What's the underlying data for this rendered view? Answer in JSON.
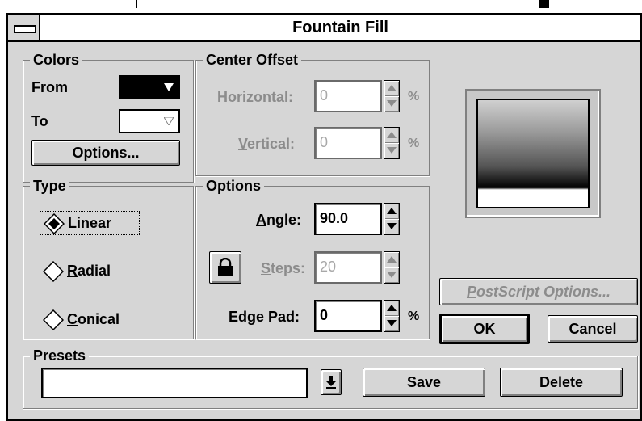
{
  "window": {
    "title": "Fountain Fill"
  },
  "colors": {
    "legend": "Colors",
    "from_label": "From",
    "to_label": "To",
    "from_color": "#000000",
    "to_color": "#ffffff",
    "options_button": "Options..."
  },
  "center_offset": {
    "legend": "Center Offset",
    "horizontal_label_accel": "H",
    "horizontal_label_rest": "orizontal:",
    "horizontal_value": "0",
    "vertical_label_accel": "V",
    "vertical_label_rest": "ertical:",
    "vertical_value": "0",
    "unit": "%"
  },
  "type": {
    "legend": "Type",
    "linear_accel": "L",
    "linear_rest": "inear",
    "radial_accel": "R",
    "radial_rest": "adial",
    "conical_accel": "C",
    "conical_rest": "onical",
    "selected": "Linear"
  },
  "options": {
    "legend": "Options",
    "angle_accel": "A",
    "angle_rest": "ngle:",
    "angle_value": "90.0",
    "steps_accel": "S",
    "steps_rest": "teps:",
    "steps_value": "20",
    "edge_pad_label": "Edge Pad:",
    "edge_pad_value": "0",
    "unit": "%",
    "lock_icon": "lock-icon"
  },
  "buttons": {
    "postscript_accel": "P",
    "postscript_rest": "ostScript Options...",
    "ok": "OK",
    "cancel": "Cancel"
  },
  "presets": {
    "legend": "Presets",
    "value": "",
    "save": "Save",
    "delete": "Delete"
  },
  "preview": {
    "gradient_from": "#000000",
    "gradient_to": "#ffffff",
    "angle": 90
  }
}
